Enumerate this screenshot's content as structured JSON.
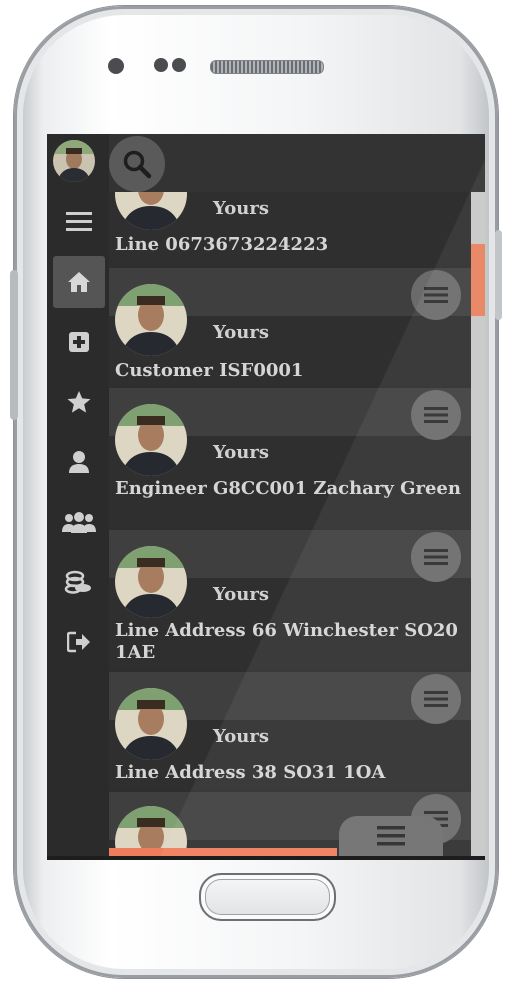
{
  "search": {
    "icon": "search-icon"
  },
  "sidebar": {
    "items": [
      {
        "icon": "menu-icon",
        "active": false
      },
      {
        "icon": "home-icon",
        "active": true
      },
      {
        "icon": "add-icon",
        "active": false
      },
      {
        "icon": "star-icon",
        "active": false
      },
      {
        "icon": "user-icon",
        "active": false
      },
      {
        "icon": "group-icon",
        "active": false
      },
      {
        "icon": "coins-icon",
        "active": false
      },
      {
        "icon": "logout-icon",
        "active": false
      }
    ]
  },
  "list": {
    "items": [
      {
        "owner": "Yours",
        "title": "Line 0673673224223"
      },
      {
        "owner": "Yours",
        "title": "Customer ISF0001"
      },
      {
        "owner": "Yours",
        "title": "Engineer G8CC001 Zachary Green"
      },
      {
        "owner": "Yours",
        "title": "Line Address 66 Winchester SO20 1AE"
      },
      {
        "owner": "Yours",
        "title": "Line Address 38 SO31 1OA"
      },
      {
        "owner": "",
        "title": ""
      }
    ]
  },
  "colors": {
    "accent": "#ef7c5a",
    "background": "#2e2e2e",
    "band": "#3f3f3f",
    "button": "#6b6b6b"
  }
}
